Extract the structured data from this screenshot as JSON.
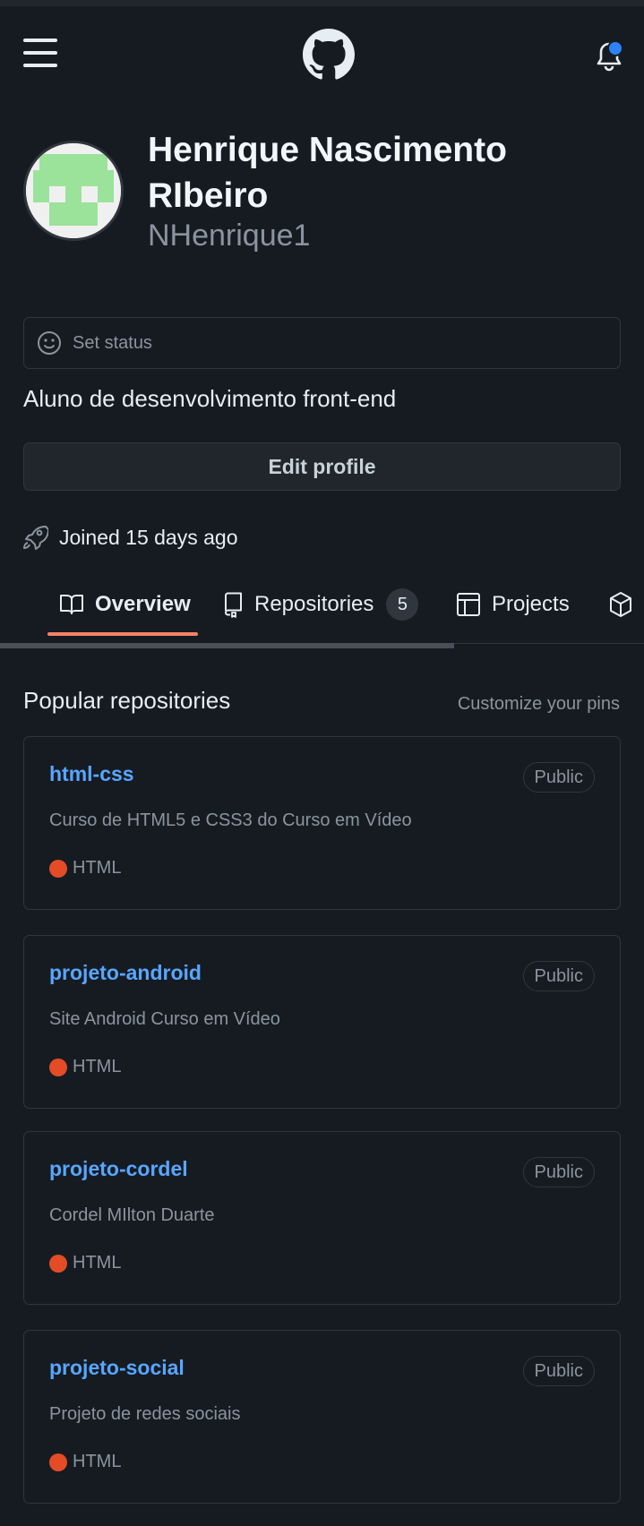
{
  "header": {
    "menu_icon": "hamburger-menu-icon",
    "logo_icon": "github-logo-icon",
    "notifications_icon": "bell-icon",
    "notification_dot_color": "#2f81f7"
  },
  "profile": {
    "avatar_icon": "identicon-avatar",
    "name": "Henrique Nascimento RIbeiro",
    "login": "NHenrique1",
    "status_placeholder": "Set status",
    "bio": "Aluno de desenvolvimento front-end",
    "edit_button": "Edit profile",
    "joined": "Joined 15 days ago"
  },
  "tabs": [
    {
      "label": "Overview",
      "icon": "book-icon",
      "active": true
    },
    {
      "label": "Repositories",
      "icon": "repo-icon",
      "count": "5"
    },
    {
      "label": "Projects",
      "icon": "table-icon"
    },
    {
      "label": "",
      "icon": "package-icon"
    }
  ],
  "popular": {
    "title": "Popular repositories",
    "customize": "Customize your pins",
    "repos": [
      {
        "name": "html-css",
        "visibility": "Public",
        "description": "Curso de HTML5 e CSS3 do Curso em Vídeo",
        "language": "HTML",
        "language_color": "#e34c26"
      },
      {
        "name": "projeto-android",
        "visibility": "Public",
        "description": "Site Android Curso em Vídeo",
        "language": "HTML",
        "language_color": "#e34c26"
      },
      {
        "name": "projeto-cordel",
        "visibility": "Public",
        "description": "Cordel MIlton Duarte",
        "language": "HTML",
        "language_color": "#e34c26"
      },
      {
        "name": "projeto-social",
        "visibility": "Public",
        "description": "Projeto de redes sociais",
        "language": "HTML",
        "language_color": "#e34c26"
      }
    ]
  },
  "colors": {
    "background": "#161b22",
    "link": "#58a6ff",
    "muted": "#8b949e",
    "tab_underline": "#f78166"
  }
}
